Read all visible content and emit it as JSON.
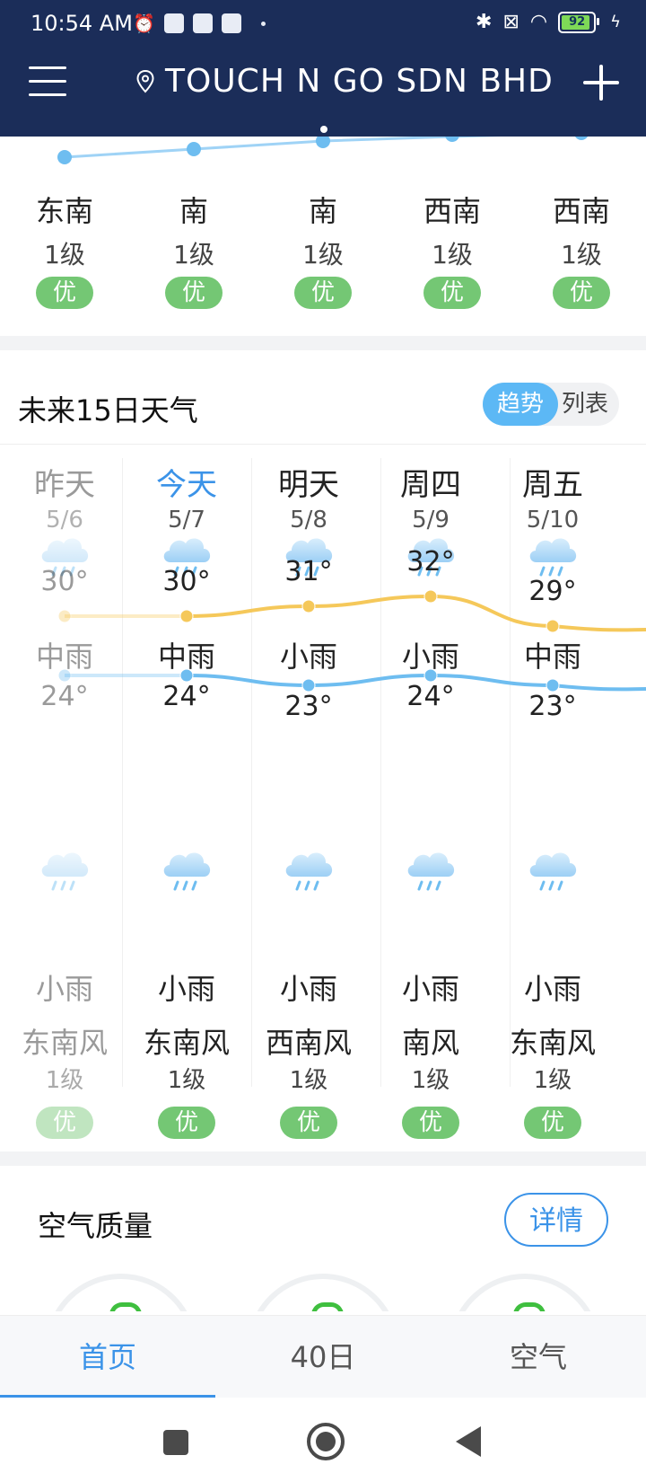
{
  "status_bar": {
    "time": "10:54 AM",
    "battery": "92"
  },
  "header": {
    "title": "TOUCH N GO SDN BHD"
  },
  "hourly": [
    {
      "dir": "东南",
      "level": "1级",
      "aqi": "优"
    },
    {
      "dir": "南",
      "level": "1级",
      "aqi": "优"
    },
    {
      "dir": "南",
      "level": "1级",
      "aqi": "优"
    },
    {
      "dir": "西南",
      "level": "1级",
      "aqi": "优"
    },
    {
      "dir": "西南",
      "level": "1级",
      "aqi": "优"
    }
  ],
  "daily_section": {
    "title": "未来15日天气",
    "toggle_trend": "趋势",
    "toggle_list": "列表"
  },
  "days": [
    {
      "name": "昨天",
      "date": "5/6",
      "day_weather": "中雨",
      "high": "30°",
      "low": "24°",
      "night_weather": "小雨",
      "wind": "东南风",
      "level": "1级",
      "aqi": "优"
    },
    {
      "name": "今天",
      "date": "5/7",
      "day_weather": "中雨",
      "high": "30°",
      "low": "24°",
      "night_weather": "小雨",
      "wind": "东南风",
      "level": "1级",
      "aqi": "优"
    },
    {
      "name": "明天",
      "date": "5/8",
      "day_weather": "小雨",
      "high": "31°",
      "low": "23°",
      "night_weather": "小雨",
      "wind": "西南风",
      "level": "1级",
      "aqi": "优"
    },
    {
      "name": "周四",
      "date": "5/9",
      "day_weather": "小雨",
      "high": "32°",
      "low": "24°",
      "night_weather": "小雨",
      "wind": "南风",
      "level": "1级",
      "aqi": "优"
    },
    {
      "name": "周五",
      "date": "5/10",
      "day_weather": "中雨",
      "high": "29°",
      "low": "23°",
      "night_weather": "小雨",
      "wind": "东南风",
      "level": "1级",
      "aqi": "优"
    }
  ],
  "air": {
    "title": "空气质量",
    "detail_button": "详情"
  },
  "tabs": [
    {
      "label": "首页"
    },
    {
      "label": "40日"
    },
    {
      "label": "空气"
    }
  ],
  "colors": {
    "header_bg": "#1b2d59",
    "accent": "#3b93e8",
    "good_aqi": "#74c774",
    "high_line": "#f5c85a",
    "low_line": "#6ebdf0"
  }
}
